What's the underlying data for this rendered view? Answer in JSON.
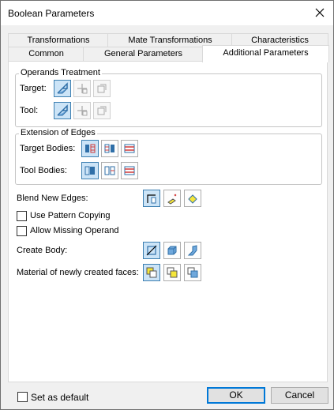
{
  "window": {
    "title": "Boolean Parameters"
  },
  "tabs": {
    "row1": [
      "Transformations",
      "Mate Transformations",
      "Characteristics"
    ],
    "row2": [
      "Common",
      "General Parameters",
      "Additional Parameters"
    ],
    "active": "Additional Parameters"
  },
  "operands": {
    "title": "Operands Treatment",
    "target_label": "Target:",
    "tool_label": "Tool:"
  },
  "extension": {
    "title": "Extension of Edges",
    "target_label": "Target Bodies:",
    "tool_label": "Tool Bodies:"
  },
  "blend": {
    "label": "Blend New Edges:"
  },
  "checks": {
    "pattern": {
      "label": "Use Pattern Copying",
      "checked": false
    },
    "missing": {
      "label": "Allow Missing Operand",
      "checked": false
    }
  },
  "create_body": {
    "label": "Create Body:"
  },
  "material": {
    "label": "Material of newly created faces:"
  },
  "footer": {
    "default_label": "Set as default",
    "default_checked": false,
    "ok": "OK",
    "cancel": "Cancel"
  },
  "icons": {
    "target": [
      "body-solid-icon",
      "move-body-icon",
      "copy-body-icon"
    ],
    "tool": [
      "body-solid-icon",
      "move-body-icon",
      "copy-body-icon"
    ],
    "ext_target": [
      "extend-left-icon",
      "extend-right-icon",
      "extend-both-icon"
    ],
    "ext_tool": [
      "extend-left-icon",
      "extend-right-icon",
      "extend-both-icon"
    ],
    "blend": [
      "blend-edge-icon",
      "blend-fillet-icon",
      "blend-chamfer-icon"
    ],
    "create": [
      "new-body-icon",
      "solid-body-icon",
      "sheet-body-icon"
    ],
    "material": [
      "material-target-icon",
      "material-tool-icon",
      "material-default-icon"
    ]
  },
  "colors": {
    "accent": "#0078d7",
    "selected_bg": "#cce4f7",
    "selected_border": "#3c7fb1",
    "icon_blue": "#2f6fa8",
    "icon_yellow": "#f5e63a",
    "icon_red": "#d23a3a"
  }
}
